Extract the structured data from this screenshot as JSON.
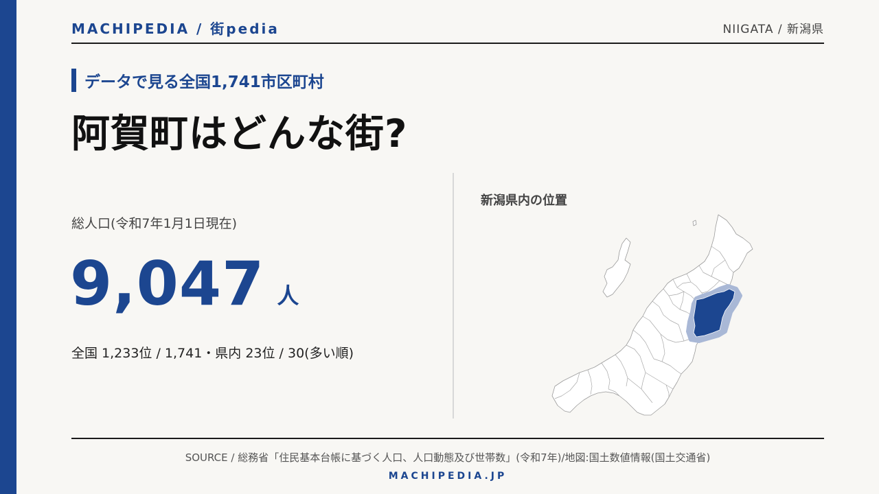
{
  "header": {
    "brand": "MACHIPEDIA / 街pedia",
    "prefecture": "NIIGATA / 新潟県"
  },
  "subtitle": "データで見る全国1,741市区町村",
  "title": "阿賀町はどんな街?",
  "population": {
    "label": "総人口(令和7年1月1日現在)",
    "value": "9,047",
    "unit": "人",
    "ranking": "全国 1,233位 / 1,741・県内 23位 / 30(多い順)"
  },
  "map": {
    "title": "新潟県内の位置",
    "highlight_color": "#1c4690",
    "halo_color": "#a9b8d6"
  },
  "footer": {
    "source": "SOURCE / 総務省「住民基本台帳に基づく人口、人口動態及び世帯数」(令和7年)/地図:国土数値情報(国土交通省)",
    "site": "MACHIPEDIA.JP"
  },
  "colors": {
    "accent": "#1c4690",
    "background": "#f8f7f4"
  }
}
